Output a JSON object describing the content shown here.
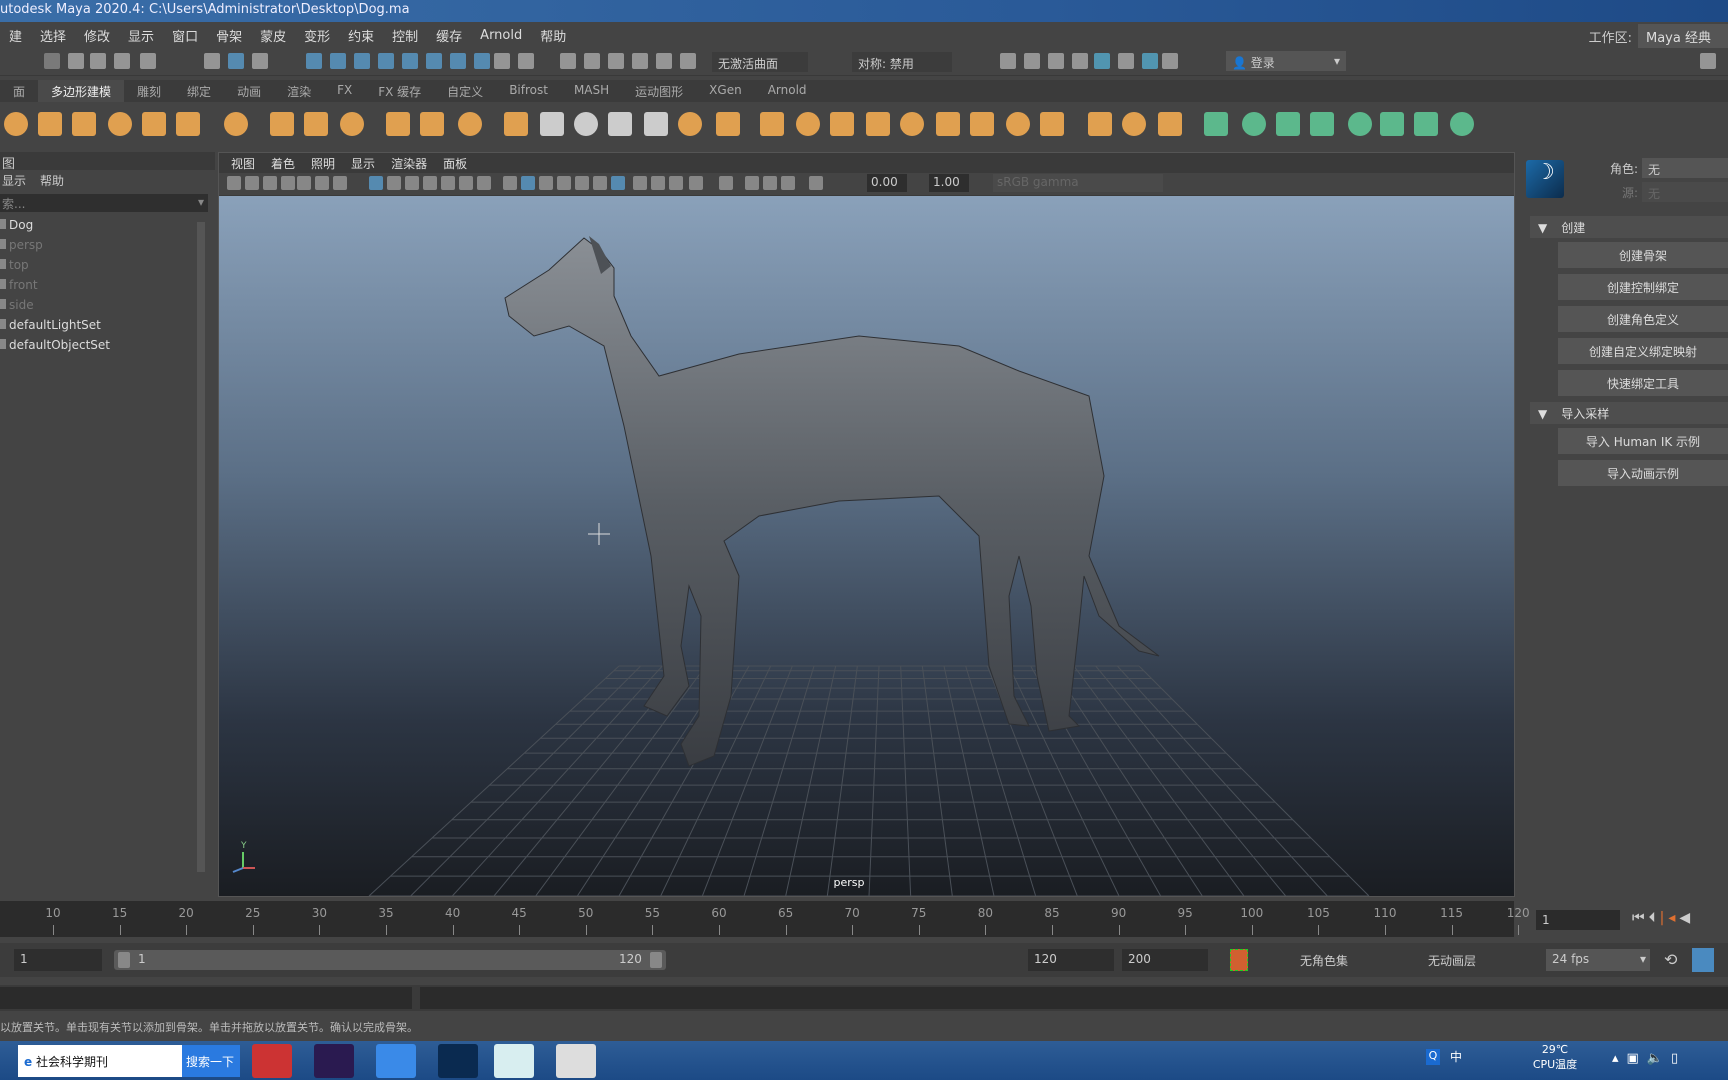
{
  "title": "utodesk Maya 2020.4: C:\\Users\\Administrator\\Desktop\\Dog.ma",
  "menus": [
    "建",
    "选择",
    "修改",
    "显示",
    "窗口",
    "骨架",
    "蒙皮",
    "变形",
    "约束",
    "控制",
    "缓存",
    "Arnold",
    "帮助"
  ],
  "workspace": {
    "label": "工作区:",
    "value": "Maya 经典"
  },
  "toolbar": {
    "live_surface": "无激活曲面",
    "symmetry": "对称: 禁用",
    "login": "登录"
  },
  "shelf_tabs": [
    "面",
    "多边形建模",
    "雕刻",
    "绑定",
    "动画",
    "渲染",
    "FX",
    "FX 缓存",
    "自定义",
    "Bifrost",
    "MASH",
    "运动图形",
    "XGen",
    "Arnold"
  ],
  "shelf_active": 1,
  "outliner": {
    "header": "图",
    "menu": [
      "显示",
      "帮助"
    ],
    "search_placeholder": "索...",
    "items": [
      {
        "label": "Dog",
        "dim": false
      },
      {
        "label": "persp",
        "dim": true
      },
      {
        "label": "top",
        "dim": true
      },
      {
        "label": "front",
        "dim": true
      },
      {
        "label": "side",
        "dim": true
      },
      {
        "label": "defaultLightSet",
        "dim": false
      },
      {
        "label": "defaultObjectSet",
        "dim": false
      }
    ]
  },
  "viewport": {
    "menus": [
      "视图",
      "着色",
      "照明",
      "显示",
      "渲染器",
      "面板"
    ],
    "exposure": "0.00",
    "gamma": "1.00",
    "color_space": "sRGB gamma",
    "camera": "persp",
    "axis_y": "Y"
  },
  "hik": {
    "character_label": "角色:",
    "character": "无",
    "source_label": "源:",
    "source": "无",
    "sections": [
      {
        "title": "创建",
        "buttons": [
          "创建骨架",
          "创建控制绑定",
          "创建角色定义",
          "创建自定义绑定映射",
          "快速绑定工具"
        ]
      },
      {
        "title": "导入采样",
        "buttons": [
          "导入 Human IK 示例",
          "导入动画示例"
        ]
      }
    ]
  },
  "timeline": {
    "ticks": [
      "10",
      "15",
      "20",
      "25",
      "30",
      "35",
      "40",
      "45",
      "50",
      "55",
      "60",
      "65",
      "70",
      "75",
      "80",
      "85",
      "90",
      "95",
      "100",
      "105",
      "110",
      "115",
      "120"
    ],
    "current_frame": "1"
  },
  "range": {
    "start": "1",
    "range_start": "1",
    "range_end": "120",
    "end": "120",
    "anim_end": "200",
    "character_set": "无角色集",
    "anim_layer": "无动画层",
    "fps": "24 fps"
  },
  "help_line": "以放置关节。单击现有关节以添加到骨架。单击并拖放以放置关节。确认以完成骨架。",
  "taskbar": {
    "search_text": "社会科学期刊",
    "search_button": "搜索一下",
    "apps": [
      "pinyin-app",
      "premiere-pro",
      "feishu",
      "photoshop",
      "maya",
      "zbrush"
    ],
    "temp": "29℃",
    "temp_label": "CPU温度",
    "ime": "中"
  },
  "colors": {
    "accent": "#5a9ccc",
    "shelf_orange": "#e0a050",
    "shelf_green": "#5cb88c"
  }
}
